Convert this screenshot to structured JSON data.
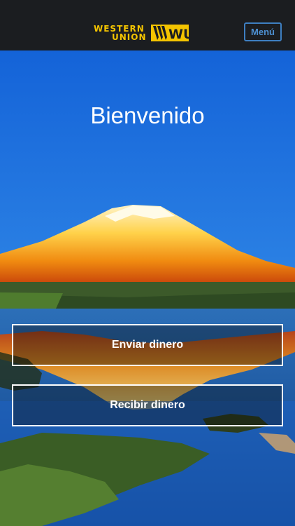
{
  "header": {
    "logo": {
      "line1": "WESTERN",
      "line2": "UNION",
      "mark": "WU"
    },
    "menu_label": "Menú"
  },
  "main": {
    "welcome": "Bienvenido",
    "actions": {
      "send_label": "Enviar dinero",
      "receive_label": "Recibir dinero"
    }
  },
  "colors": {
    "brand_yellow": "#f4c400",
    "header_bg": "#1b1d20",
    "menu_blue": "#3e7fc1",
    "sky_top": "#1463d8",
    "sky_bottom": "#5ca7f0"
  },
  "icons": {
    "logo": "western-union-logo"
  }
}
